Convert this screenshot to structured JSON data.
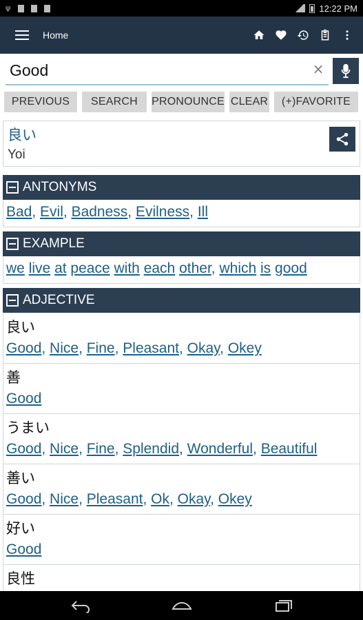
{
  "status_bar": {
    "time": "12:22 PM"
  },
  "app_bar": {
    "title": "Home",
    "actions": [
      "home-icon",
      "heart-icon",
      "history-icon",
      "clipboard-icon",
      "more-vert-icon"
    ]
  },
  "search": {
    "value": "Good",
    "placeholder": ""
  },
  "buttons": {
    "previous": "PREVIOUS",
    "search": "SEARCH",
    "pronounce": "PRONOUNCE",
    "clear": "CLEAR",
    "favorite": "(+)FAVORITE"
  },
  "word": {
    "japanese": "良い",
    "romaji": "Yoi"
  },
  "antonyms": {
    "heading": "ANTONYMS",
    "items": [
      "Bad",
      "Evil",
      "Badness",
      "Evilness",
      "Ill"
    ]
  },
  "example": {
    "heading": "EXAMPLE",
    "words": [
      "we",
      "live",
      "at",
      "peace",
      "with",
      "each",
      "other",
      "which",
      "is",
      "good"
    ]
  },
  "adjective": {
    "heading": "ADJECTIVE",
    "entries": [
      {
        "jp": "良い",
        "en": [
          "Good",
          "Nice",
          "Fine",
          "Pleasant",
          "Okay",
          "Okey"
        ]
      },
      {
        "jp": "善",
        "en": [
          "Good"
        ]
      },
      {
        "jp": "うまい",
        "en": [
          "Good",
          "Nice",
          "Fine",
          "Splendid",
          "Wonderful",
          "Beautiful"
        ]
      },
      {
        "jp": "善い",
        "en": [
          "Good",
          "Nice",
          "Pleasant",
          "Ok",
          "Okay",
          "Okey"
        ]
      },
      {
        "jp": "好い",
        "en": [
          "Good"
        ]
      },
      {
        "jp": "良性",
        "en": []
      }
    ]
  },
  "colors": {
    "app_bar": "#243447",
    "section_header": "#2c3e52",
    "link": "#1d5f86",
    "button_bg": "#d7d7d7"
  }
}
